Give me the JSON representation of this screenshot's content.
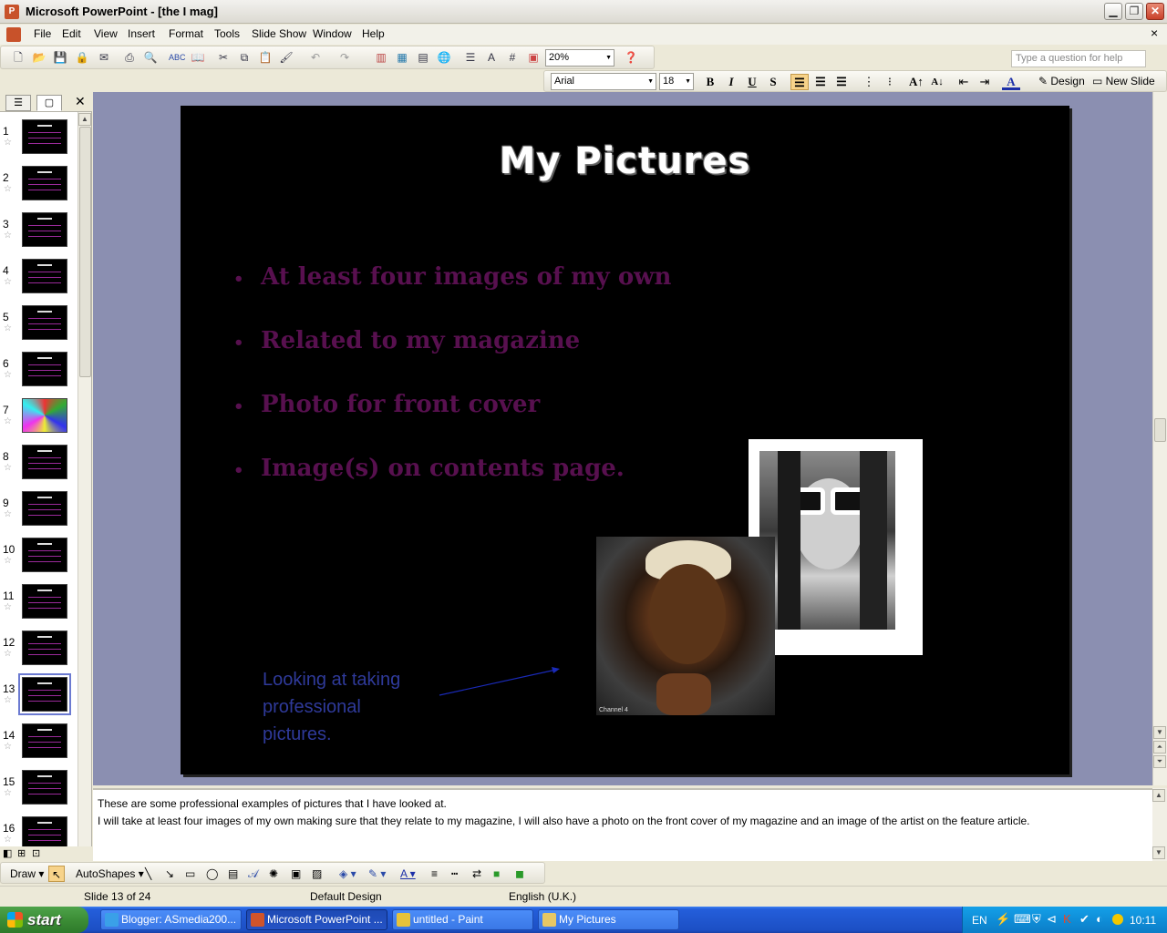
{
  "window": {
    "title": "Microsoft PowerPoint - [the I mag]",
    "app_icon": "powerpoint-icon",
    "buttons": [
      "minimize-icon",
      "restore-icon",
      "close-icon"
    ]
  },
  "menu": {
    "items": [
      "File",
      "Edit",
      "View",
      "Insert",
      "Format",
      "Tools",
      "Slide Show",
      "Window",
      "Help"
    ],
    "help_placeholder": "Type a question for help",
    "close_glyph": "×"
  },
  "toolbar_standard": {
    "zoom": "20%"
  },
  "toolbar_formatting": {
    "font": "Arial",
    "size": "18",
    "bold": "B",
    "italic": "I",
    "underline": "U",
    "shadow": "S",
    "design_label": "Design",
    "new_slide_label": "New Slide"
  },
  "slide_panel": {
    "selected": 13,
    "slides": [
      "1",
      "2",
      "3",
      "4",
      "5",
      "6",
      "7",
      "8",
      "9",
      "10",
      "11",
      "12",
      "13",
      "14",
      "15",
      "16"
    ]
  },
  "slide": {
    "title": "My Pictures",
    "bullets": [
      "At least four images of my own",
      "Related to my magazine",
      "Photo for front cover",
      "Image(s) on contents page."
    ],
    "bullet_glyph": "•",
    "caption_lines": [
      "Looking at taking",
      "professional",
      "pictures."
    ],
    "photo_watermark": "Channel 4"
  },
  "notes": {
    "line1": "These are some professional examples of pictures that I have looked at.",
    "line2": "I will take at least four images of my own making sure that they relate to my magazine, I will also have a photo on the front cover of my magazine and an image of the artist on the feature article."
  },
  "drawing_toolbar": {
    "draw_label": "Draw",
    "autoshapes_label": "AutoShapes"
  },
  "status": {
    "slide": "Slide 13 of 24",
    "design": "Default Design",
    "language": "English (U.K.)"
  },
  "taskbar": {
    "start_label": "start",
    "tasks": [
      {
        "label": "Blogger: ASmedia200...",
        "icon": "internet-explorer-icon"
      },
      {
        "label": "Microsoft PowerPoint ...",
        "icon": "powerpoint-icon",
        "active": true
      },
      {
        "label": "untitled - Paint",
        "icon": "paint-icon"
      },
      {
        "label": "My Pictures",
        "icon": "folder-icon"
      }
    ],
    "lang": "EN",
    "clock": "10:11"
  },
  "colors": {
    "bullet_text": "#58104f",
    "caption_text": "#2f3a9a",
    "slide_bg": "#000000",
    "workspace": "#8b8fb1"
  }
}
